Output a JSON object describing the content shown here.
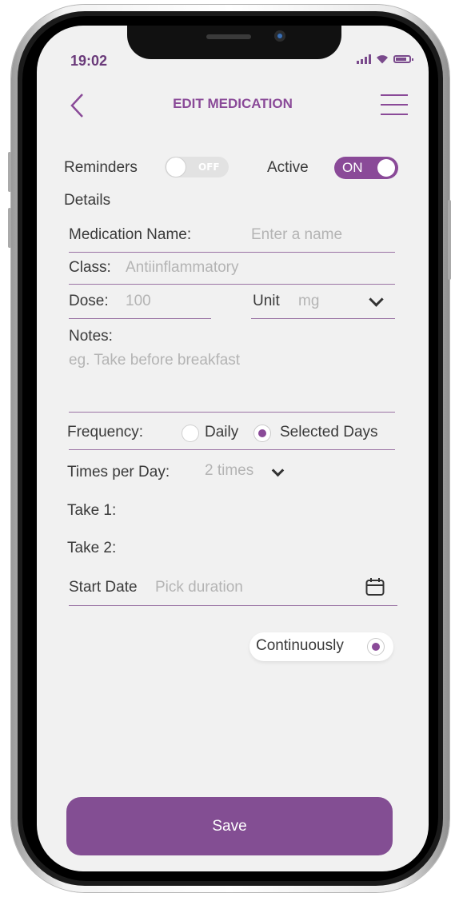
{
  "status_bar": {
    "time": "19:02"
  },
  "header": {
    "title": "EDIT MEDICATION",
    "back_icon": "chevron-left-icon",
    "menu_icon": "hamburger-menu-icon"
  },
  "toggles": {
    "reminders_label": "Reminders",
    "reminders_state": "OFF",
    "active_label": "Active",
    "active_state": "ON"
  },
  "details": {
    "section_label": "Details",
    "medication_name_label": "Medication Name:",
    "medication_name_placeholder": "Enter a name",
    "class_label": "Class:",
    "class_value": "Antiinflammatory",
    "dose_label": "Dose:",
    "dose_placeholder": "100",
    "unit_label": "Unit",
    "unit_value": "mg",
    "notes_label": "Notes:",
    "notes_placeholder": "eg. Take before breakfast"
  },
  "frequency": {
    "label": "Frequency:",
    "options": [
      "Daily",
      "Selected Days"
    ],
    "selected": "Selected Days"
  },
  "times": {
    "label": "Times per Day:",
    "value": "2 times",
    "take1": "Take 1:",
    "take2": "Take 2:"
  },
  "start_date": {
    "label": "Start Date",
    "placeholder": "Pick duration"
  },
  "continuously": {
    "label": "Continuously",
    "selected": true
  },
  "save_button": {
    "label": "Save"
  },
  "colors": {
    "accent": "#8a4a98",
    "button": "#834e93",
    "background": "#f1f1f1"
  }
}
